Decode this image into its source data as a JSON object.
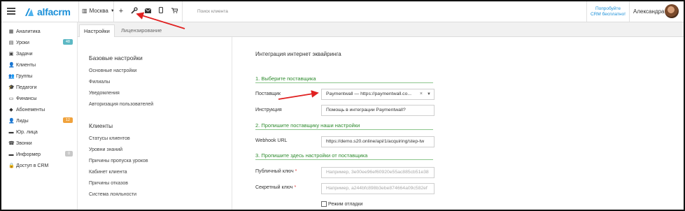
{
  "topbar": {
    "logo_text": "alfacrm",
    "branch": "Москва",
    "search_placeholder": "Поиск клиента",
    "promo_line1": "Попробуйте",
    "promo_line2": "CRM бесплатно!",
    "username": "Александра",
    "icons": [
      "plus-icon",
      "wrench-icon",
      "envelope-icon",
      "mobile-icon",
      "cart-icon"
    ]
  },
  "sidebar": {
    "items": [
      {
        "label": "Аналитика",
        "icon": "chart-icon",
        "glyph": "▦"
      },
      {
        "label": "Уроки",
        "icon": "calendar-icon",
        "glyph": "▤",
        "badge": "48",
        "badge_color": "#5cb8c4"
      },
      {
        "label": "Задачи",
        "icon": "tasks-icon",
        "glyph": "▣"
      },
      {
        "label": "Клиенты",
        "icon": "user-icon",
        "glyph": "👤"
      },
      {
        "label": "Группы",
        "icon": "users-icon",
        "glyph": "👥"
      },
      {
        "label": "Педагоги",
        "icon": "graduation-cap-icon",
        "glyph": "🎓"
      },
      {
        "label": "Финансы",
        "icon": "money-icon",
        "glyph": "▭"
      },
      {
        "label": "Абонементы",
        "icon": "tag-icon",
        "glyph": "◆"
      },
      {
        "label": "Лиды",
        "icon": "user-plus-icon",
        "glyph": "👤",
        "badge": "12",
        "badge_color": "#f0a23c"
      },
      {
        "label": "Юр. лица",
        "icon": "briefcase-icon",
        "glyph": "▬"
      },
      {
        "label": "Звонки",
        "icon": "phone-icon",
        "glyph": "☎"
      },
      {
        "label": "Информер",
        "icon": "inbox-icon",
        "glyph": "▬",
        "badge": "0",
        "badge_color": "#c8c8c8"
      },
      {
        "label": "Доступ в CRM",
        "icon": "lock-icon",
        "glyph": "🔒"
      }
    ]
  },
  "tabs": [
    {
      "label": "Настройки",
      "active": true
    },
    {
      "label": "Лицензирование",
      "active": false
    }
  ],
  "settings_menu": {
    "basic_heading": "Базовые настройки",
    "basic_links": [
      "Основные настройки",
      "Филиалы",
      "Уведомления",
      "Авторизация пользователей"
    ],
    "clients_heading": "Клиенты",
    "clients_links": [
      "Статусы клиентов",
      "Уровни знаний",
      "Причины пропуска уроков",
      "Кабинет клиента",
      "Причины отказов",
      "Система лояльности"
    ]
  },
  "content": {
    "title": "Интеграция интернет эквайринга",
    "section1": "1. Выберите поставщика",
    "provider_label": "Поставщик",
    "provider_value": "Paymentwall — https://paymentwall.co...",
    "instruction_label": "Инструкция",
    "instruction_value": "Помощь в интеграции Paymentwall?",
    "section2": "2. Пропишите поставщику наши настройки",
    "webhook_label": "Webhook URL",
    "webhook_value": "https://demo.s20.online/api/1/acquiring/step-tw",
    "section3": "3. Пропишите здесь настройки от поставщика",
    "public_key_label": "Публичный ключ",
    "public_key_placeholder": "Например, 3e00ee96ef60920e55ac885cb51e38",
    "secret_key_label": "Секретный ключ",
    "secret_key_placeholder": "Например, a244bfc898b3ebe874664a09c582ef",
    "debug_label": "Режим отладки",
    "required_mark": "*"
  },
  "colors": {
    "brand": "#1a8fd8",
    "section_green": "#2e8b2e",
    "annotation_arrow": "#e02020"
  }
}
